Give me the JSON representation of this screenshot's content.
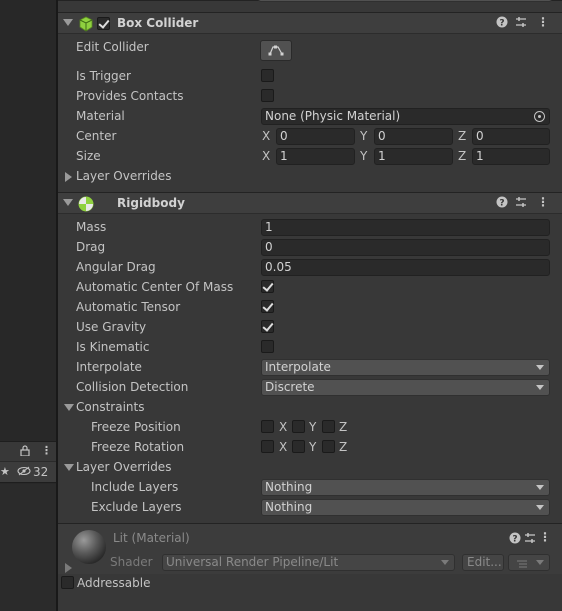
{
  "left": {
    "visibility_count": "32"
  },
  "box_collider": {
    "title": "Box Collider",
    "edit_collider_label": "Edit Collider",
    "is_trigger_label": "Is Trigger",
    "provides_contacts_label": "Provides Contacts",
    "material_label": "Material",
    "material_value": "None (Physic Material)",
    "center_label": "Center",
    "center": {
      "x": "0",
      "y": "0",
      "z": "0"
    },
    "size_label": "Size",
    "size": {
      "x": "1",
      "y": "1",
      "z": "1"
    },
    "layer_overrides_label": "Layer Overrides",
    "axis_x": "X",
    "axis_y": "Y",
    "axis_z": "Z"
  },
  "rigidbody": {
    "title": "Rigidbody",
    "mass_label": "Mass",
    "mass_value": "1",
    "drag_label": "Drag",
    "drag_value": "0",
    "angular_drag_label": "Angular Drag",
    "angular_drag_value": "0.05",
    "auto_center_label": "Automatic Center Of Mass",
    "auto_tensor_label": "Automatic Tensor",
    "use_gravity_label": "Use Gravity",
    "is_kinematic_label": "Is Kinematic",
    "interpolate_label": "Interpolate",
    "interpolate_value": "Interpolate",
    "collision_detection_label": "Collision Detection",
    "collision_detection_value": "Discrete",
    "constraints_label": "Constraints",
    "freeze_position_label": "Freeze Position",
    "freeze_rotation_label": "Freeze Rotation",
    "axis_x": "X",
    "axis_y": "Y",
    "axis_z": "Z",
    "layer_overrides_label": "Layer Overrides",
    "include_layers_label": "Include Layers",
    "include_layers_value": "Nothing",
    "exclude_layers_label": "Exclude Layers",
    "exclude_layers_value": "Nothing"
  },
  "material": {
    "title": "Lit (Material)",
    "shader_label": "Shader",
    "shader_value": "Universal Render Pipeline/Lit",
    "edit_label": "Edit...",
    "addressable_label": "Addressable"
  },
  "colors": {
    "background": "#383838",
    "field": "#2a2a2a",
    "header": "#3e3e3e",
    "text": "#c4c4c4"
  }
}
